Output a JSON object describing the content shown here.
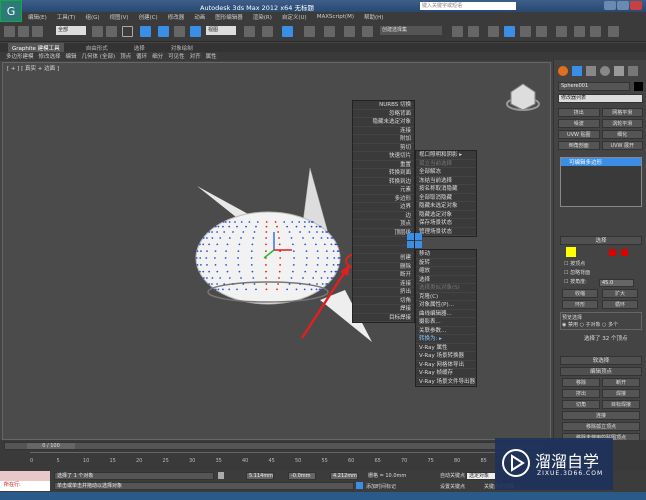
{
  "title_bar": {
    "title": "Autodesk 3ds Max  2012 x64    无标题",
    "search_placeholder": "键入关键字或短语"
  },
  "menu": [
    "编辑(E)",
    "工具(T)",
    "组(G)",
    "视图(V)",
    "创建(C)",
    "修改器",
    "动画",
    "图形编辑器",
    "渲染(R)",
    "自定义(U)",
    "MAXScript(M)",
    "帮助(H)"
  ],
  "toolbar": {
    "selection_filter": "全部",
    "view_dropdown": "视图",
    "named_selection": "创建选择集"
  },
  "ribbon": {
    "tabs": [
      "Graphite 建模工具",
      "自由形式",
      "选择",
      "对象绘制"
    ],
    "subtabs": [
      "多边形建模",
      "修改选择",
      "编辑",
      "几何体 (全部)",
      "顶点",
      "循环",
      "细分",
      "可见性",
      "对齐",
      "属性"
    ]
  },
  "viewport": {
    "label": "[ + ] [ 真实 + 边面 ]"
  },
  "quad_menu": {
    "left": [
      "NURBS 切换",
      "忽略背面",
      "隐藏未选定对象",
      "连接",
      "附加",
      "剪切",
      "快速切片",
      "重置",
      "转换到面",
      "转换到边",
      "元素",
      "多边形",
      "边界",
      "边",
      "顶点",
      "顶层级",
      "",
      "",
      "创建",
      "删除",
      "断开",
      "连接",
      "挤出",
      "切角",
      "焊接",
      "目标焊接"
    ],
    "right_top": [
      "视口照明和阴影 ▸",
      "孤立当前选择",
      "全部解冻",
      "冻结当前选择",
      "按名称取消隐藏",
      "全部取消隐藏",
      "隐藏未选定对象",
      "隐藏选定对象",
      "保存场景状态",
      "管理场景状态"
    ],
    "right_bottom": [
      "移动",
      "旋转",
      "缩放",
      "选择",
      "选择类似对象(S)",
      "克隆(C)",
      "对象属性(P)...",
      "曲线编辑器...",
      "摄影表...",
      "关联参数...",
      "转换为: ▸",
      "V-Ray 属性",
      "V-Ray 场景转换器",
      "V-Ray 网格体导出",
      "V-Ray 帧缓存",
      "V-Ray 场景文件导出器"
    ]
  },
  "command_panel": {
    "object_name": "Sphere001",
    "modifier_list": "修改器列表",
    "buttons": [
      "挤出",
      "网格平滑",
      "噪波",
      "涡轮平滑",
      "UVW 贴图",
      "细化",
      "倒角剖面",
      "UVW 展开"
    ],
    "stack_item": "可编辑多边形",
    "selection_rollout": "选择",
    "checkboxes": [
      "按顶点",
      "忽略背面",
      "按角度:"
    ],
    "angle_value": "45.0",
    "shrink": "收缩",
    "grow": "扩大",
    "ring": "环形",
    "loop": "循环",
    "preview_label": "预览选择",
    "preview_options": [
      "禁用",
      "子对象",
      "多个"
    ],
    "selected_status": "选择了 32 个顶点",
    "soft_selection": "软选择",
    "edit_vertices": "编辑顶点",
    "edit_buttons": [
      "移除",
      "断开",
      "挤出",
      "焊接",
      "切角",
      "目标焊接",
      "连接",
      "移除孤立顶点",
      "移除未使用的贴图顶点"
    ]
  },
  "timeline": {
    "frame": "0 / 100",
    "ticks": [
      "0",
      "5",
      "10",
      "15",
      "20",
      "25",
      "30",
      "35",
      "40",
      "45",
      "50",
      "55",
      "60",
      "65",
      "70",
      "75",
      "80",
      "85",
      "90"
    ]
  },
  "status": {
    "mode": "所在行:",
    "selection": "选择了 1 个对象",
    "prompt": "单击或单击并拖动以选择对象",
    "x": "5.114mm",
    "y": "-0.0mm",
    "z": "4.212mm",
    "grid": "栅格 = 10.0mm",
    "auto_key": "自动关键点",
    "set_key": "设置关键点",
    "key_filter": "关键点过滤器...",
    "selected_dropdown": "选定对象",
    "add_time_tag": "添加时间标记"
  },
  "watermark": {
    "brand": "溜溜自学",
    "url": "ZIXUE.3D66.COM"
  },
  "colors": {
    "accent": "#3a8ee6",
    "highlight_red": "#e02020",
    "selection_yellow": "#ffff00"
  }
}
